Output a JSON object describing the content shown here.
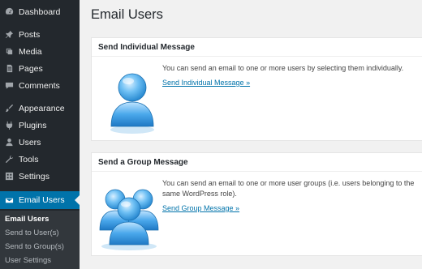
{
  "sidebar": {
    "items": [
      {
        "label": "Dashboard",
        "icon": "dashboard-icon"
      },
      {
        "label": "Posts",
        "icon": "pin-icon"
      },
      {
        "label": "Media",
        "icon": "media-icon"
      },
      {
        "label": "Pages",
        "icon": "pages-icon"
      },
      {
        "label": "Comments",
        "icon": "comment-icon"
      },
      {
        "label": "Appearance",
        "icon": "brush-icon"
      },
      {
        "label": "Plugins",
        "icon": "plugin-icon"
      },
      {
        "label": "Users",
        "icon": "users-icon"
      },
      {
        "label": "Tools",
        "icon": "wrench-icon"
      },
      {
        "label": "Settings",
        "icon": "settings-icon"
      },
      {
        "label": "Email Users",
        "icon": "email-icon"
      }
    ],
    "submenu": [
      {
        "label": "Email Users"
      },
      {
        "label": "Send to User(s)"
      },
      {
        "label": "Send to Group(s)"
      },
      {
        "label": "User Settings"
      }
    ]
  },
  "page": {
    "title": "Email Users"
  },
  "individual": {
    "header": "Send Individual Message",
    "text": "You can send an email to one or more users by selecting them individually.",
    "link": "Send Individual Message »",
    "icon": "single-user-icon"
  },
  "group": {
    "header": "Send a Group Message",
    "text": "You can send an email to one or more user groups (i.e. users belonging to the same WordPress role).",
    "link": "Send Group Message »",
    "icon": "user-group-icon"
  },
  "colors": {
    "sidebar_bg": "#23282d",
    "submenu_bg": "#32373c",
    "accent": "#0073aa",
    "page_bg": "#f1f1f1"
  }
}
